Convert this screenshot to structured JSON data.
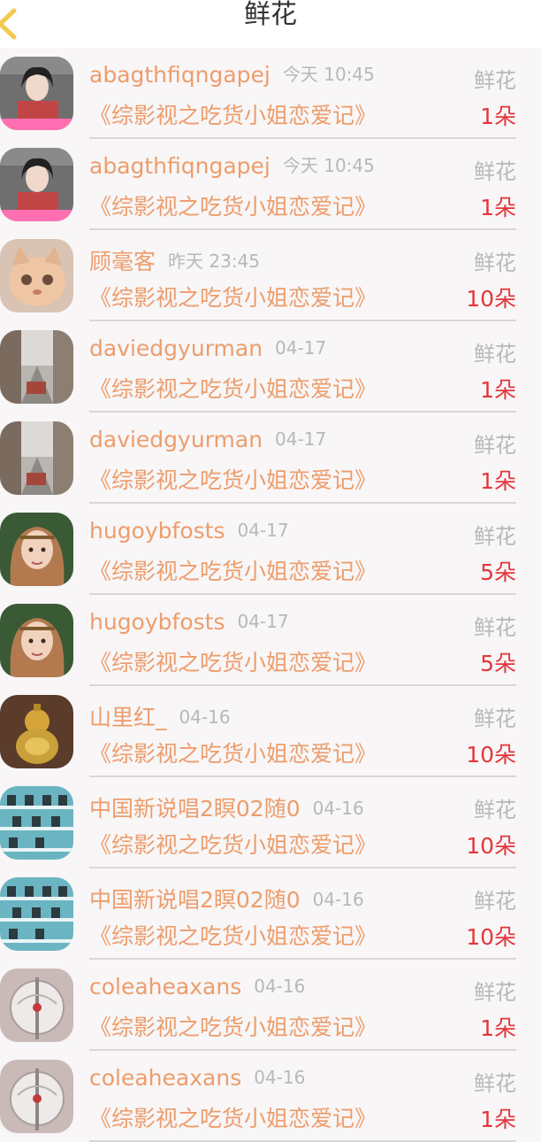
{
  "header": {
    "title": "鲜花",
    "back_icon": "chevron-left-icon",
    "accent": "#f2c94c"
  },
  "colors": {
    "name": "#ed9d6c",
    "meta": "#b8b8b8",
    "count": "#e4363c"
  },
  "items": [
    {
      "user": "abagthfiqngapej",
      "time": "今天 10:45",
      "gift": "鲜花",
      "book": "《综影视之吃货小姐恋爱记》",
      "count": "1朵",
      "avatar": "portrait-woman-pink-banner"
    },
    {
      "user": "abagthfiqngapej",
      "time": "今天 10:45",
      "gift": "鲜花",
      "book": "《综影视之吃货小姐恋爱记》",
      "count": "1朵",
      "avatar": "portrait-woman-pink-banner"
    },
    {
      "user": "顾毫客",
      "time": "昨天 23:45",
      "gift": "鲜花",
      "book": "《综影视之吃货小姐恋爱记》",
      "count": "10朵",
      "avatar": "cat-photo"
    },
    {
      "user": "daviedgyurman",
      "time": "04-17",
      "gift": "鲜花",
      "book": "《综影视之吃货小姐恋爱记》",
      "count": "1朵",
      "avatar": "street-photo"
    },
    {
      "user": "daviedgyurman",
      "time": "04-17",
      "gift": "鲜花",
      "book": "《综影视之吃货小姐恋爱记》",
      "count": "1朵",
      "avatar": "street-photo"
    },
    {
      "user": "hugoybfosts",
      "time": "04-17",
      "gift": "鲜花",
      "book": "《综影视之吃货小姐恋爱记》",
      "count": "5朵",
      "avatar": "portrait-woman-headband"
    },
    {
      "user": "hugoybfosts",
      "time": "04-17",
      "gift": "鲜花",
      "book": "《综影视之吃货小姐恋爱记》",
      "count": "5朵",
      "avatar": "portrait-woman-headband"
    },
    {
      "user": "山里红_",
      "time": "04-16",
      "gift": "鲜花",
      "book": "《综影视之吃货小姐恋爱记》",
      "count": "10朵",
      "avatar": "golden-gourd-photo"
    },
    {
      "user": "中国新说唱2瞑02随0",
      "time": "04-16",
      "gift": "鲜花",
      "book": "《综影视之吃货小姐恋爱记》",
      "count": "10朵",
      "avatar": "shelf-photo"
    },
    {
      "user": "中国新说唱2瞑02随0",
      "time": "04-16",
      "gift": "鲜花",
      "book": "《综影视之吃货小姐恋爱记》",
      "count": "10朵",
      "avatar": "shelf-photo"
    },
    {
      "user": "coleaheaxans",
      "time": "04-16",
      "gift": "鲜花",
      "book": "《综影视之吃货小姐恋爱记》",
      "count": "1朵",
      "avatar": "glass-ornament-photo"
    },
    {
      "user": "coleaheaxans",
      "time": "04-16",
      "gift": "鲜花",
      "book": "《综影视之吃货小姐恋爱记》",
      "count": "1朵",
      "avatar": "glass-ornament-photo"
    }
  ]
}
